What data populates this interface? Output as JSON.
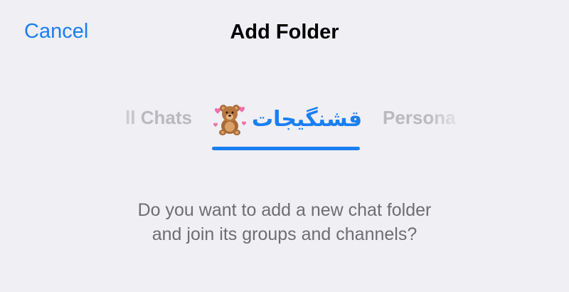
{
  "header": {
    "cancel_label": "Cancel",
    "title": "Add Folder"
  },
  "tabs": [
    {
      "label": "All Chats",
      "visible_text": "ll Chats",
      "state": "inactive"
    },
    {
      "label": "قشنگیجات",
      "icon": "teddy-bear-with-hearts-emoji",
      "state": "active"
    },
    {
      "label": "Personal",
      "visible_text": "Persona",
      "state": "inactive"
    }
  ],
  "message": {
    "line1": "Do you want to add a new chat folder",
    "line2": "and join its groups and channels?"
  },
  "colors": {
    "accent": "#1a7ff0",
    "background": "#efeff4",
    "inactive_tab": "#b9b9be",
    "message_text": "#6d6d72"
  }
}
